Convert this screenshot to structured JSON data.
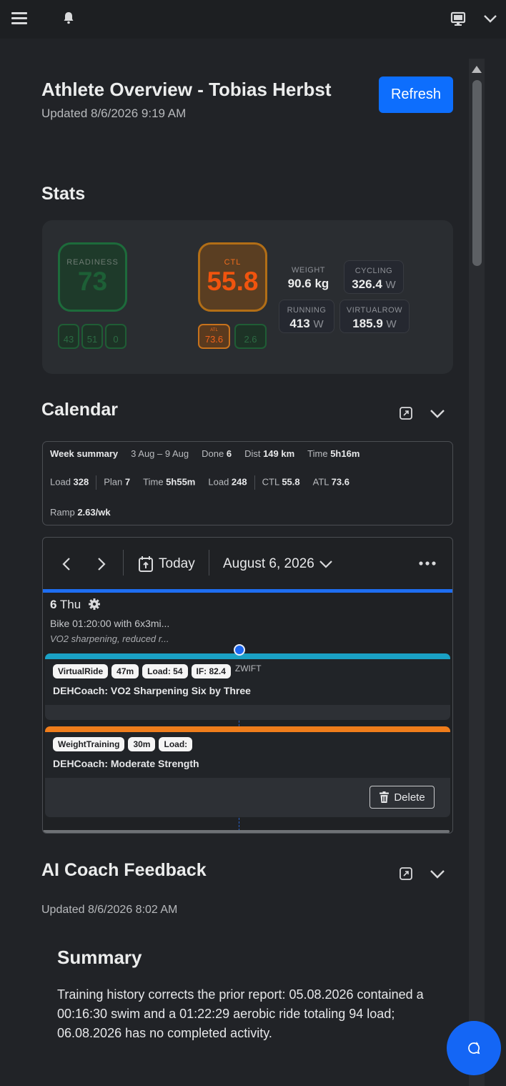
{
  "header": {
    "title": "Athlete Overview - Tobias Herbst",
    "updated": "Updated 8/6/2026 9:19 AM",
    "refresh_label": "Refresh"
  },
  "stats": {
    "title": "Stats",
    "readiness": {
      "label": "READINESS",
      "value": "73",
      "subs": [
        "43",
        "51",
        "0"
      ]
    },
    "ctl": {
      "label": "CTL",
      "value": "55.8",
      "atl_label": "ATL",
      "atl_value": "73.6",
      "tsb_value": "2.6"
    },
    "metrics": [
      {
        "label": "WEIGHT",
        "value": "90.6 kg",
        "unit": ""
      },
      {
        "label": "CYCLING",
        "value": "326.4",
        "unit": "W"
      },
      {
        "label": "RUNNING",
        "value": "413",
        "unit": "W"
      },
      {
        "label": "VIRTUALROW",
        "value": "185.9",
        "unit": "W"
      }
    ]
  },
  "calendar": {
    "title": "Calendar",
    "week": {
      "label": "Week summary",
      "range": "3 Aug – 9 Aug",
      "done_label": "Done",
      "done_value": "6",
      "dist_label": "Dist",
      "dist_value": "149 km",
      "time_label": "Time",
      "time_value": "5h16m",
      "load_label": "Load",
      "load_value": "328",
      "plan_label": "Plan",
      "plan_value": "7",
      "plan_time_label": "Time",
      "plan_time_value": "5h55m",
      "plan_load_label": "Load",
      "plan_load_value": "248",
      "ctl_label": "CTL",
      "ctl_value": "55.8",
      "atl_label": "ATL",
      "atl_value": "73.6",
      "ramp_label": "Ramp",
      "ramp_value": "2.63/wk"
    },
    "toolbar": {
      "today_label": "Today",
      "date_label": "August 6, 2026"
    },
    "day": {
      "num": "6",
      "weekday": "Thu",
      "summary": "Bike 01:20:00 with 6x3mi...",
      "note": "VO2 sharpening, reduced r..."
    },
    "events": [
      {
        "tags": [
          "VirtualRide",
          "47m",
          "Load: 54",
          "IF: 82.4"
        ],
        "source": "ZWIFT",
        "title": "DEHCoach: VO2 Sharpening Six by Three",
        "color": "#1aa1c5"
      },
      {
        "tags": [
          "WeightTraining",
          "30m",
          "Load:"
        ],
        "source": "",
        "title": "DEHCoach: Moderate Strength",
        "color": "#f07d1b"
      }
    ],
    "delete_label": "Delete"
  },
  "ai": {
    "title": "AI Coach Feedback",
    "updated": "Updated 8/6/2026 8:02 AM",
    "summary_title": "Summary",
    "summary_text": "Training history corrects the prior report: 05.08.2026 contained a 00:16:30 swim and a 01:22:29 aerobic ride totaling 94 load; 06.08.2026 has no completed activity."
  },
  "colors": {
    "accent": "#0d6efd",
    "readiness": "#1d6b3b",
    "ctl": "#f0540e"
  }
}
